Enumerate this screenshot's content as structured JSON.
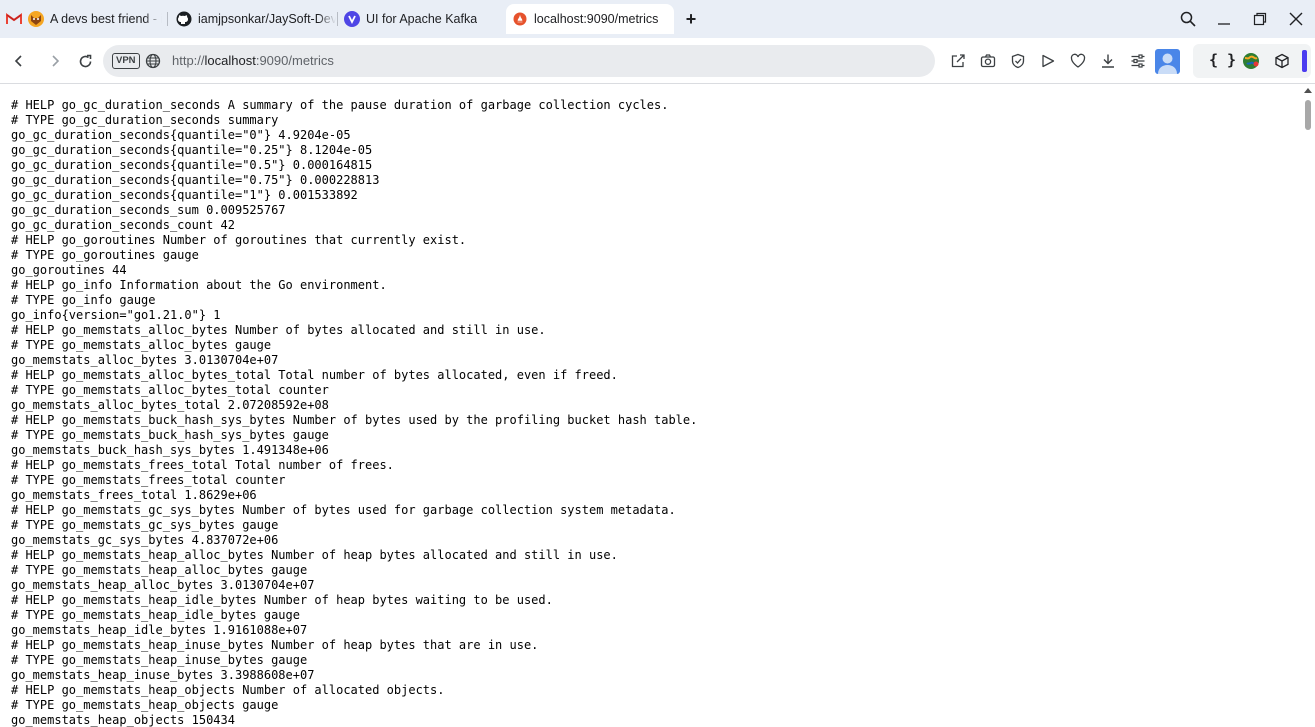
{
  "tabs": [
    {
      "label": "A devs best friend - ia"
    },
    {
      "label": "iamjpsonkar/JaySoft-DevE"
    },
    {
      "label": "UI for Apache Kafka"
    },
    {
      "label": "localhost:9090/metrics",
      "active": true
    }
  ],
  "address_bar": {
    "vpn_label": "VPN",
    "scheme": "http://",
    "host": "localhost",
    "rest": ":9090/metrics"
  },
  "toolbar_icons": [
    "share-icon",
    "camera-icon",
    "shield-icon",
    "play-icon",
    "heart-icon",
    "download-icon",
    "settings-icon"
  ],
  "extension_label": "{ }",
  "colors": {
    "tab_bar": "#e9eef6",
    "omnibox": "#e9ebee",
    "accent": "#4b3cf0"
  },
  "metrics_lines": [
    "# HELP go_gc_duration_seconds A summary of the pause duration of garbage collection cycles.",
    "# TYPE go_gc_duration_seconds summary",
    "go_gc_duration_seconds{quantile=\"0\"} 4.9204e-05",
    "go_gc_duration_seconds{quantile=\"0.25\"} 8.1204e-05",
    "go_gc_duration_seconds{quantile=\"0.5\"} 0.000164815",
    "go_gc_duration_seconds{quantile=\"0.75\"} 0.000228813",
    "go_gc_duration_seconds{quantile=\"1\"} 0.001533892",
    "go_gc_duration_seconds_sum 0.009525767",
    "go_gc_duration_seconds_count 42",
    "# HELP go_goroutines Number of goroutines that currently exist.",
    "# TYPE go_goroutines gauge",
    "go_goroutines 44",
    "# HELP go_info Information about the Go environment.",
    "# TYPE go_info gauge",
    "go_info{version=\"go1.21.0\"} 1",
    "# HELP go_memstats_alloc_bytes Number of bytes allocated and still in use.",
    "# TYPE go_memstats_alloc_bytes gauge",
    "go_memstats_alloc_bytes 3.0130704e+07",
    "# HELP go_memstats_alloc_bytes_total Total number of bytes allocated, even if freed.",
    "# TYPE go_memstats_alloc_bytes_total counter",
    "go_memstats_alloc_bytes_total 2.07208592e+08",
    "# HELP go_memstats_buck_hash_sys_bytes Number of bytes used by the profiling bucket hash table.",
    "# TYPE go_memstats_buck_hash_sys_bytes gauge",
    "go_memstats_buck_hash_sys_bytes 1.491348e+06",
    "# HELP go_memstats_frees_total Total number of frees.",
    "# TYPE go_memstats_frees_total counter",
    "go_memstats_frees_total 1.8629e+06",
    "# HELP go_memstats_gc_sys_bytes Number of bytes used for garbage collection system metadata.",
    "# TYPE go_memstats_gc_sys_bytes gauge",
    "go_memstats_gc_sys_bytes 4.837072e+06",
    "# HELP go_memstats_heap_alloc_bytes Number of heap bytes allocated and still in use.",
    "# TYPE go_memstats_heap_alloc_bytes gauge",
    "go_memstats_heap_alloc_bytes 3.0130704e+07",
    "# HELP go_memstats_heap_idle_bytes Number of heap bytes waiting to be used.",
    "# TYPE go_memstats_heap_idle_bytes gauge",
    "go_memstats_heap_idle_bytes 1.9161088e+07",
    "# HELP go_memstats_heap_inuse_bytes Number of heap bytes that are in use.",
    "# TYPE go_memstats_heap_inuse_bytes gauge",
    "go_memstats_heap_inuse_bytes 3.3988608e+07",
    "# HELP go_memstats_heap_objects Number of allocated objects.",
    "# TYPE go_memstats_heap_objects gauge",
    "go_memstats_heap_objects 150434"
  ]
}
